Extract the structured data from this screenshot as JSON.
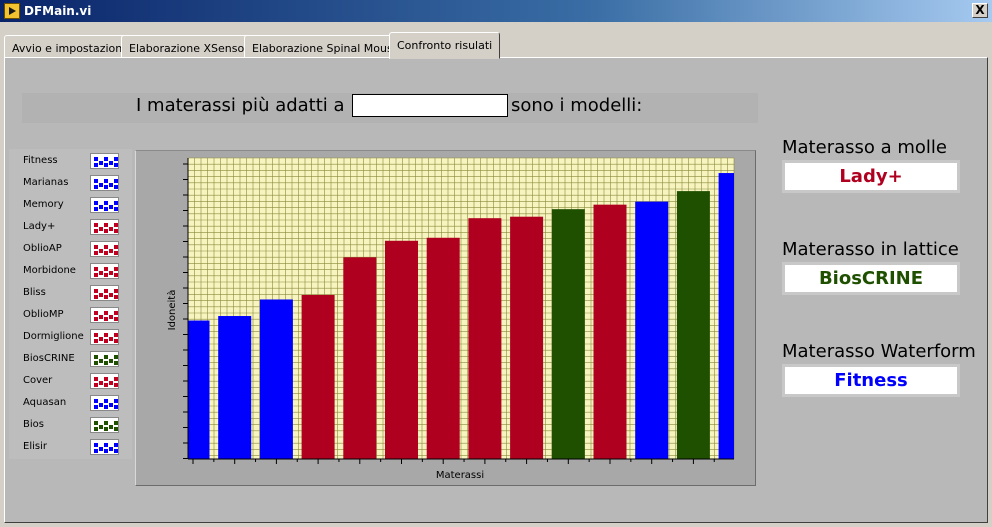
{
  "window": {
    "title": "DFMain.vi",
    "close_label": "X"
  },
  "tabs": [
    {
      "label": "Avvio e impostazioni",
      "active": false
    },
    {
      "label": "Elaborazione XSensor",
      "active": false
    },
    {
      "label": "Elaborazione Spinal Mouse",
      "active": false
    },
    {
      "label": "Confronto risulati",
      "active": true
    }
  ],
  "header": {
    "prefix": "I materassi più adatti a",
    "input_value": "",
    "suffix": "sono i modelli:"
  },
  "legend": [
    {
      "name": "Fitness",
      "color": "#0000ff"
    },
    {
      "name": "Marianas",
      "color": "#0000ff"
    },
    {
      "name": "Memory",
      "color": "#0000ff"
    },
    {
      "name": "Lady+",
      "color": "#c00020"
    },
    {
      "name": "OblioAP",
      "color": "#c00020"
    },
    {
      "name": "Morbidone",
      "color": "#c00020"
    },
    {
      "name": "Bliss",
      "color": "#c00020"
    },
    {
      "name": "OblioMP",
      "color": "#c00020"
    },
    {
      "name": "Dormiglione",
      "color": "#c00020"
    },
    {
      "name": "BiosCRINE",
      "color": "#1e5000"
    },
    {
      "name": "Cover",
      "color": "#c00020"
    },
    {
      "name": "Aquasan",
      "color": "#0000ff"
    },
    {
      "name": "Bios",
      "color": "#1e5000"
    },
    {
      "name": "Elisir",
      "color": "#0000ff"
    }
  ],
  "chart_data": {
    "type": "bar",
    "xlabel": "Materassi",
    "ylabel": "Idoneità",
    "ylim": [
      0,
      100
    ],
    "grid": true,
    "tick_labels_visible": false,
    "values": [
      46,
      47.5,
      53,
      54.5,
      67,
      72.5,
      73.5,
      80,
      80.5,
      83,
      84.5,
      85.5,
      89,
      95
    ],
    "colors": [
      "#0000ff",
      "#0000ff",
      "#0000ff",
      "#b00020",
      "#b00020",
      "#b00020",
      "#b00020",
      "#b00020",
      "#b00020",
      "#1e5000",
      "#b00020",
      "#0000ff",
      "#1e5000",
      "#0000ff"
    ]
  },
  "results": [
    {
      "title": "Materasso a molle",
      "value": "Lady+",
      "color": "#b00020"
    },
    {
      "title": "Materasso in lattice",
      "value": "BiosCRINE",
      "color": "#1e5000"
    },
    {
      "title": "Materasso Waterform",
      "value": "Fitness",
      "color": "#0000ff"
    }
  ]
}
